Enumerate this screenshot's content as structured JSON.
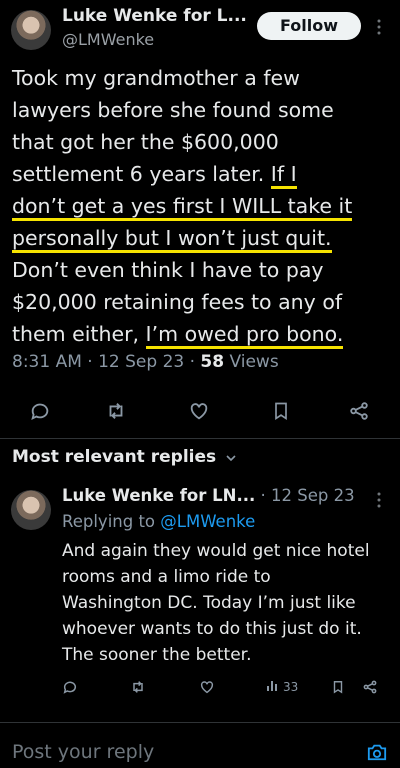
{
  "tweet": {
    "author_name": "Luke Wenke for L...",
    "author_handle": "@LMWenke",
    "follow_label": "Follow",
    "lines": [
      {
        "text": "Took my grandmother a few",
        "underline": ""
      },
      {
        "text": "lawyers before she found some",
        "underline": ""
      },
      {
        "text": "that got her the $600,000",
        "underline": ""
      },
      {
        "text": "settlement 6 years later. ",
        "underline": "If I"
      },
      {
        "text": "",
        "underline": "don’t get a yes first I WILL take it"
      },
      {
        "text": "",
        "underline": "personally but I won’t just quit."
      },
      {
        "text": "Don’t even think I have to pay",
        "underline": ""
      },
      {
        "text": "$20,000 retaining fees to any of",
        "underline": ""
      },
      {
        "text": "them either, ",
        "underline": "I’m owed pro bono."
      }
    ],
    "time": "8:31 AM · 12 Sep 23 · ",
    "views_count": "58",
    "views_label": " Views"
  },
  "replies_header": "Most relevant replies",
  "reply": {
    "author_name": "Luke Wenke for LN...",
    "date": " · 12 Sep 23",
    "replying_to_label": "Replying to ",
    "replying_to_handle": "@LMWenke",
    "lines": [
      "And again they would get nice hotel",
      "rooms and a limo ride to",
      "Washington DC.  Today I’m just like",
      "whoever wants to do this just do it.",
      "The sooner the better."
    ],
    "views": "33"
  },
  "compose": {
    "placeholder": "Post your reply"
  },
  "colors": {
    "highlight": "#f6e300",
    "accent": "#1d9bf0",
    "background": "#000000"
  }
}
